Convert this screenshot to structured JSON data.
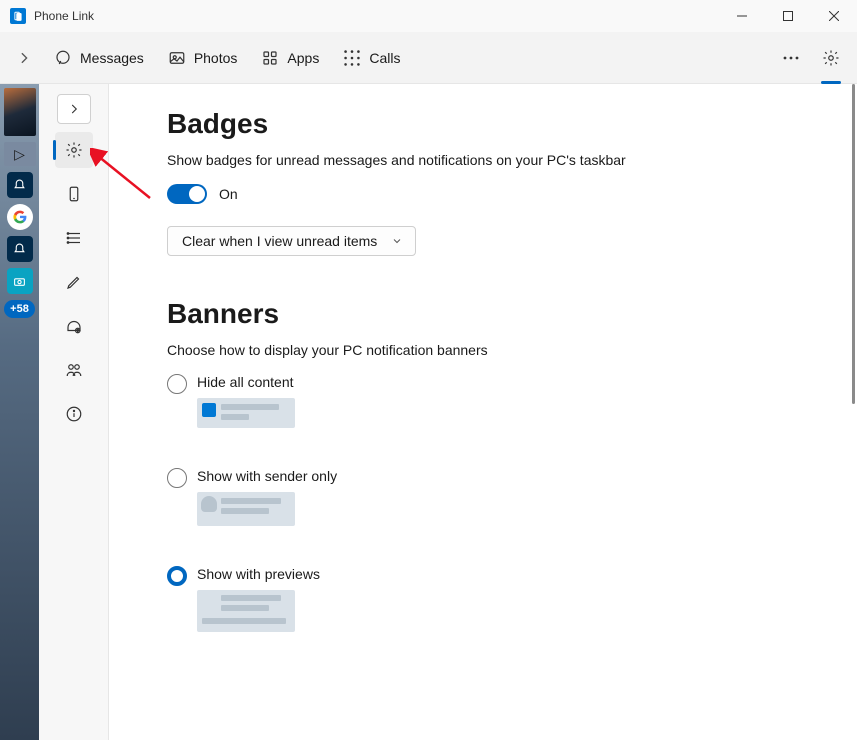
{
  "app": {
    "title": "Phone Link"
  },
  "topnav": {
    "items": [
      {
        "label": "Messages"
      },
      {
        "label": "Photos"
      },
      {
        "label": "Apps"
      },
      {
        "label": "Calls"
      }
    ]
  },
  "os_strip": {
    "badge": "+58"
  },
  "sidebar": {
    "icons": [
      "gear-icon",
      "phone-icon",
      "list-icon",
      "pen-icon",
      "headset-icon",
      "people-icon",
      "info-icon"
    ]
  },
  "badges": {
    "heading": "Badges",
    "description": "Show badges for unread messages and notifications on your PC's taskbar",
    "toggle_label": "On",
    "dropdown": "Clear when I view unread items"
  },
  "banners": {
    "heading": "Banners",
    "description": "Choose how to display your PC notification banners",
    "options": [
      {
        "label": "Hide all content"
      },
      {
        "label": "Show with sender only"
      },
      {
        "label": "Show with previews"
      }
    ],
    "selected_index": 2
  }
}
